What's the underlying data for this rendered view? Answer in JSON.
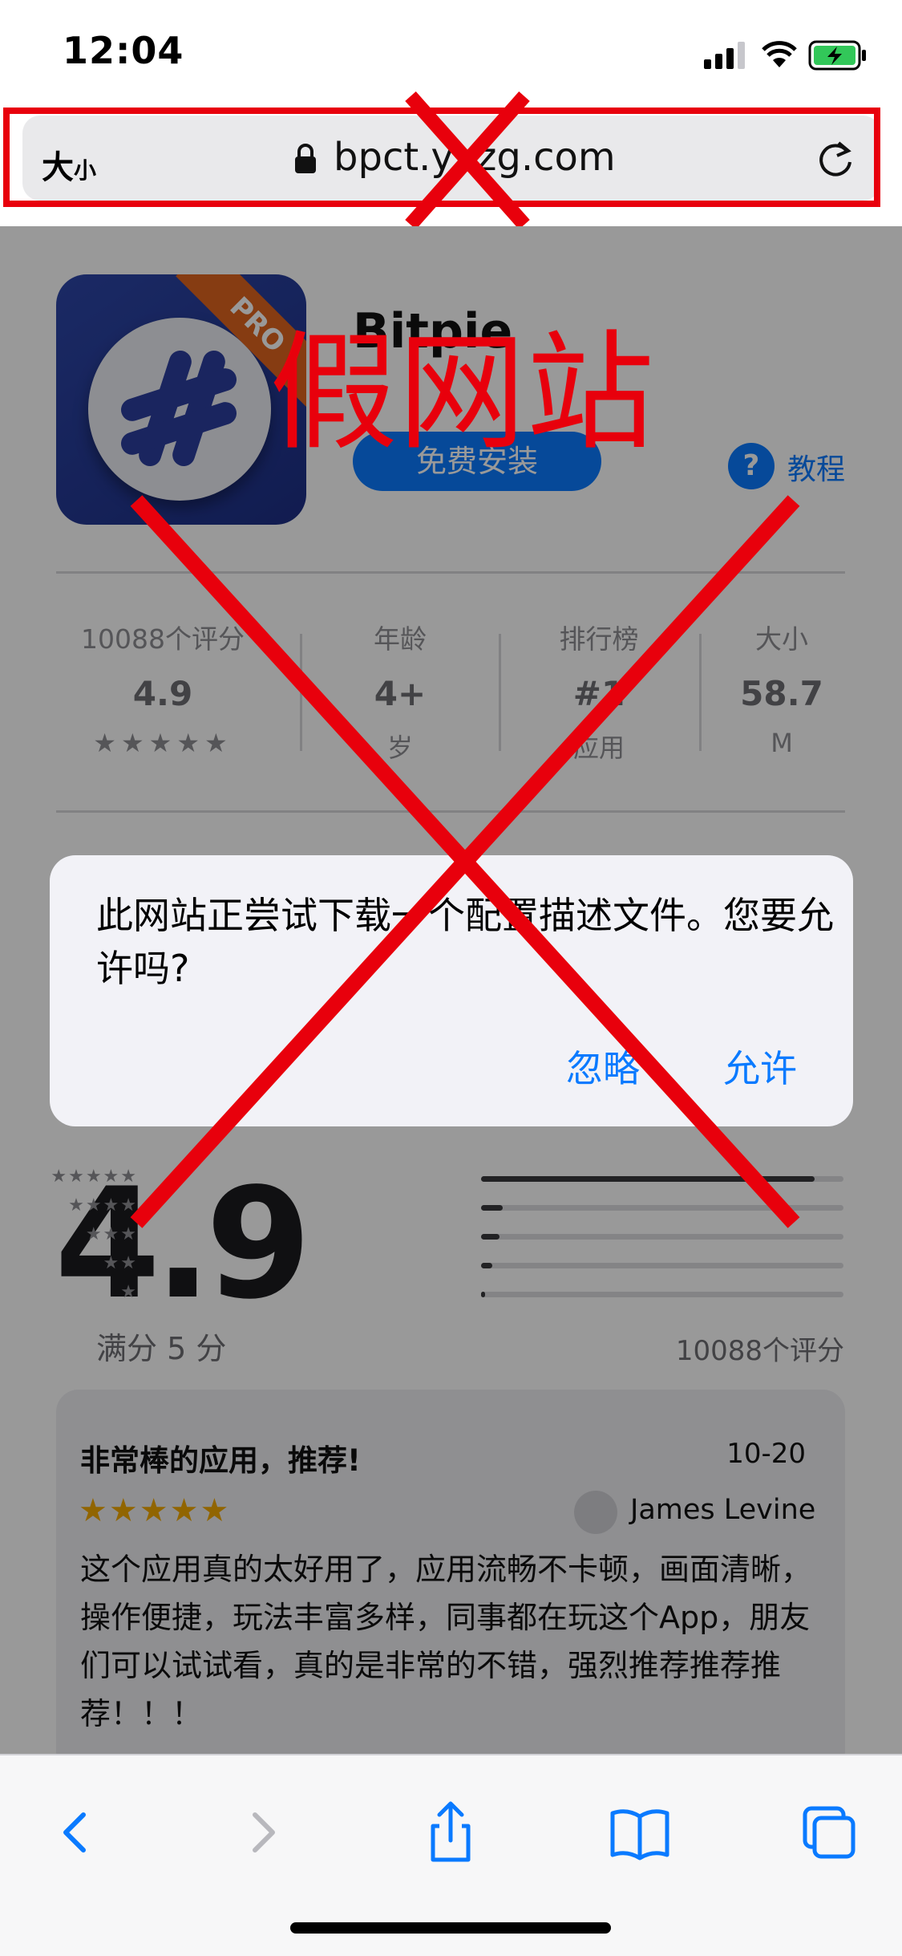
{
  "status_bar": {
    "time": "12:04"
  },
  "browser": {
    "text_size_label": "大",
    "text_size_small": "小",
    "url": "bpct.yxzg.com"
  },
  "annotation": {
    "label": "假网站",
    "cross_color": "#e8000c"
  },
  "app": {
    "name": "Bitpie",
    "badge": "PRO",
    "install_label": "免费安装",
    "help_label": "教程"
  },
  "stats": [
    {
      "label": "10088个评分",
      "value": "4.9",
      "sub": "★★★★★"
    },
    {
      "label": "年龄",
      "value": "4+",
      "sub": "岁"
    },
    {
      "label": "排行榜",
      "value": "#1",
      "sub": "应用"
    },
    {
      "label": "大小",
      "value": "58.7",
      "sub": "M"
    }
  ],
  "dialog": {
    "message": "此网站正尝试下载一个配置描述文件。您要允许吗?",
    "ignore_label": "忽略",
    "allow_label": "允许"
  },
  "ratings": {
    "score": "4.9",
    "out_of": "满分 5 分",
    "count": "10088个评分",
    "bars": [
      {
        "stars": "★★★★★",
        "fraction": 0.92
      },
      {
        "stars": "★★★★",
        "fraction": 0.06
      },
      {
        "stars": "★★★",
        "fraction": 0.05
      },
      {
        "stars": "★★",
        "fraction": 0.03
      },
      {
        "stars": "★",
        "fraction": 0.01
      }
    ]
  },
  "review": {
    "title": "非常棒的应用，推荐!",
    "date": "10-20",
    "stars": "★★★★★",
    "author": "James Levine",
    "body": "这个应用真的太好用了，应用流畅不卡顿，画面清晰，操作便捷，玩法丰富多样，同事都在玩这个App，朋友们可以试试看，真的是非常的不错，强烈推荐推荐推荐！！！"
  },
  "toolbar": {
    "back": "back-icon",
    "forward": "forward-icon",
    "share": "share-icon",
    "bookmarks": "bookmarks-icon",
    "tabs": "tabs-icon"
  }
}
